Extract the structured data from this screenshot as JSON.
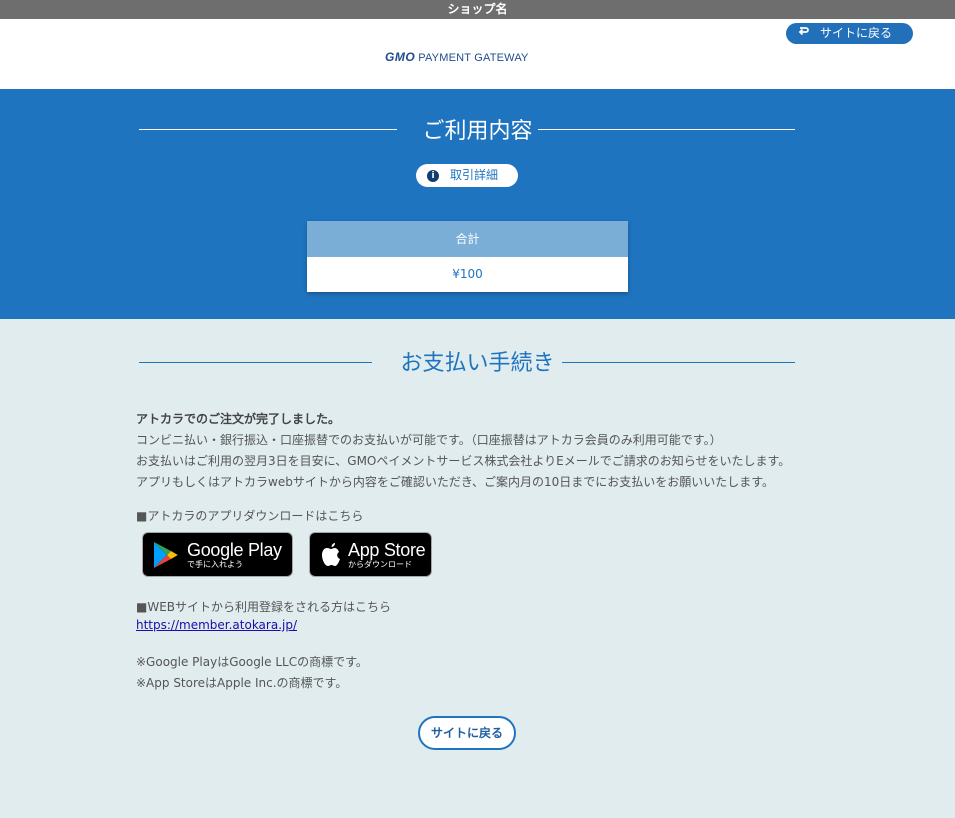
{
  "topbar": {
    "shop_name": "ショップ名"
  },
  "header": {
    "logo_gmo": "GMO",
    "logo_text": "PAYMENT GATEWAY",
    "back_button": "サイトに戻る",
    "back_icon": "return-arrow-icon"
  },
  "summary": {
    "title": "ご利用内容",
    "detail_button": "取引詳細",
    "detail_icon": "info-icon",
    "total_label": "合計",
    "total_value": "¥100"
  },
  "payment": {
    "title": "お支払い手続き",
    "lead": "アトカラでのご注文が完了しました。",
    "lines": [
      "コンビニ払い・銀行振込・口座振替でのお支払いが可能です。（口座振替はアトカラ会員のみ利用可能です。）",
      "お支払いはご利用の翌月3日を目安に、GMOペイメントサービス株式会社よりEメールでご請求のお知らせをいたします。",
      "アプリもしくはアトカラwebサイトから内容をご確認いただき、ご案内月の10日までにお支払いをお願いいたします。"
    ],
    "app_heading": "■アトカラのアプリダウンロードはこちら",
    "google_play": {
      "big": "Google Play",
      "small": "で手に入れよう",
      "icon": "google-play-icon"
    },
    "app_store": {
      "big": "App Store",
      "small": "からダウンロード",
      "icon": "apple-icon"
    },
    "web_heading": "■WEBサイトから利用登録をされる方はこちら",
    "web_link": "https://member.atokara.jp/",
    "notes": [
      "※Google PlayはGoogle LLCの商標です。",
      "※App StoreはApple Inc.の商標です。"
    ],
    "back_button": "サイトに戻る"
  },
  "colors": {
    "primary": "#1f74bf",
    "background": "#e0ecee",
    "topbar": "#6e6e6e",
    "total_header": "#7aaed7"
  }
}
